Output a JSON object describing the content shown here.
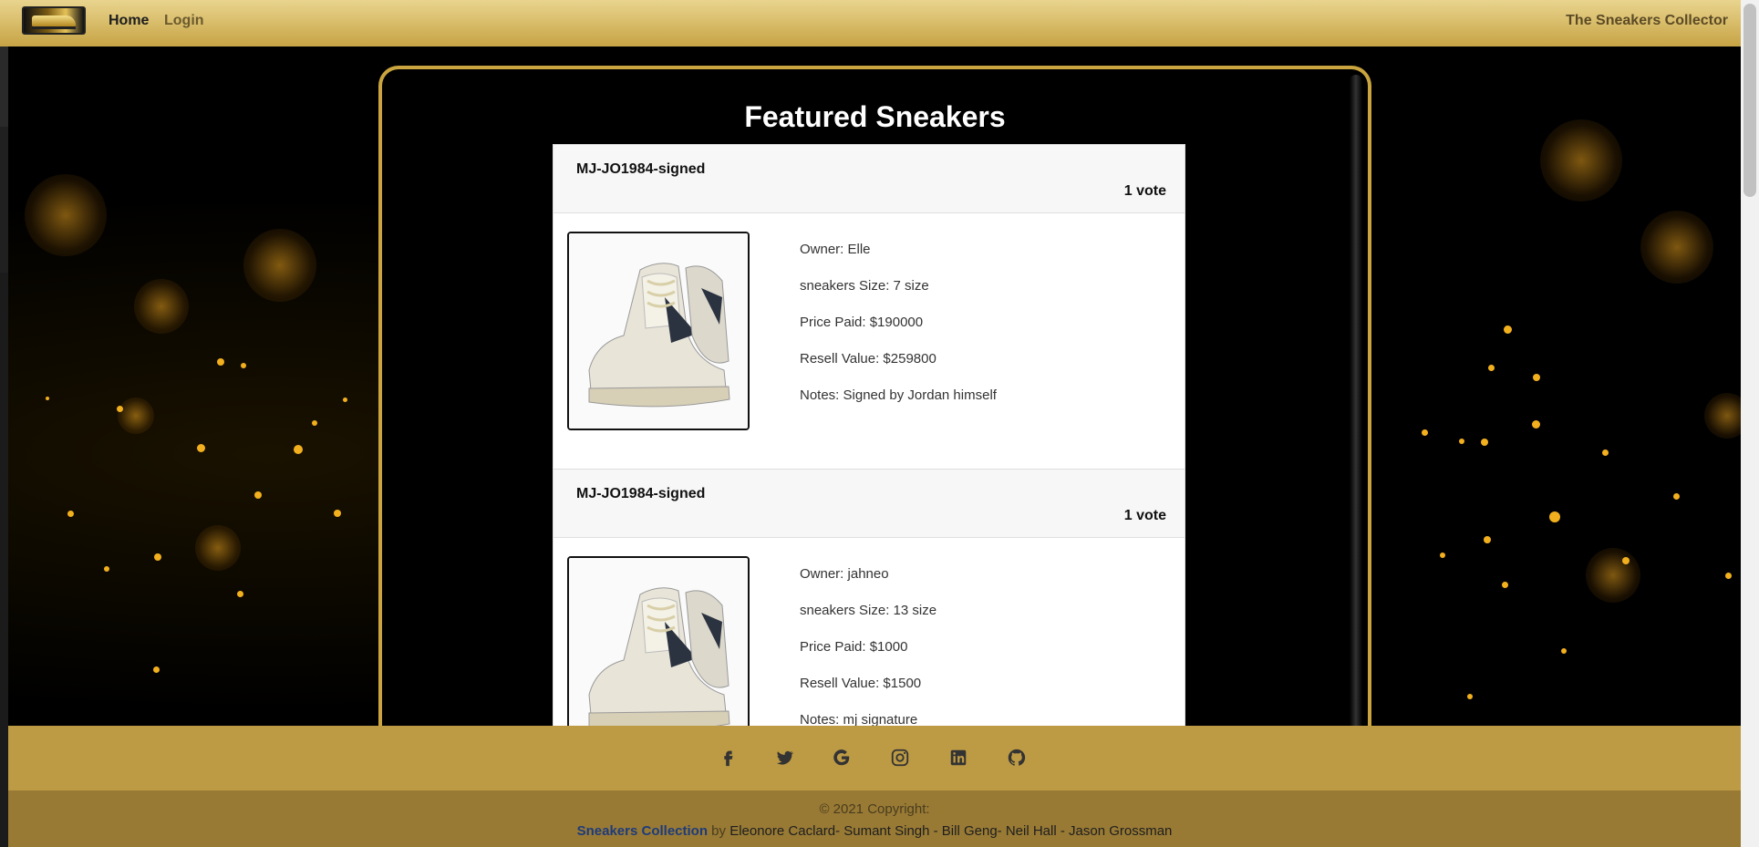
{
  "navbar": {
    "home": "Home",
    "login": "Login",
    "brand_right": "The Sneakers Collector"
  },
  "page": {
    "title": "Featured Sneakers"
  },
  "cards": [
    {
      "name": "MJ-JO1984-signed",
      "votes": "1 vote",
      "owner": "Owner: Elle",
      "size": "sneakers Size: 7 size",
      "price": "Price Paid: $190000",
      "resell": "Resell Value: $259800",
      "notes": "Notes: Signed by Jordan himself"
    },
    {
      "name": "MJ-JO1984-signed",
      "votes": "1 vote",
      "owner": "Owner: jahneo",
      "size": "sneakers Size: 13 size",
      "price": "Price Paid: $1000",
      "resell": "Resell Value: $1500",
      "notes": "Notes: mj signature"
    }
  ],
  "footer": {
    "social_icons": [
      "facebook-icon",
      "twitter-icon",
      "google-icon",
      "instagram-icon",
      "linkedin-icon",
      "github-icon"
    ],
    "copyright": "© 2021 Copyright:",
    "site_name": "Sneakers Collection",
    "by": "by",
    "authors": "Eleonore Caclard- Sumant Singh - Bill Geng- Neil Hall - Jason Grossman"
  },
  "colors": {
    "gold": "#c9a43f",
    "footer_top": "#bd9a44",
    "footer_bottom": "#987a35"
  }
}
